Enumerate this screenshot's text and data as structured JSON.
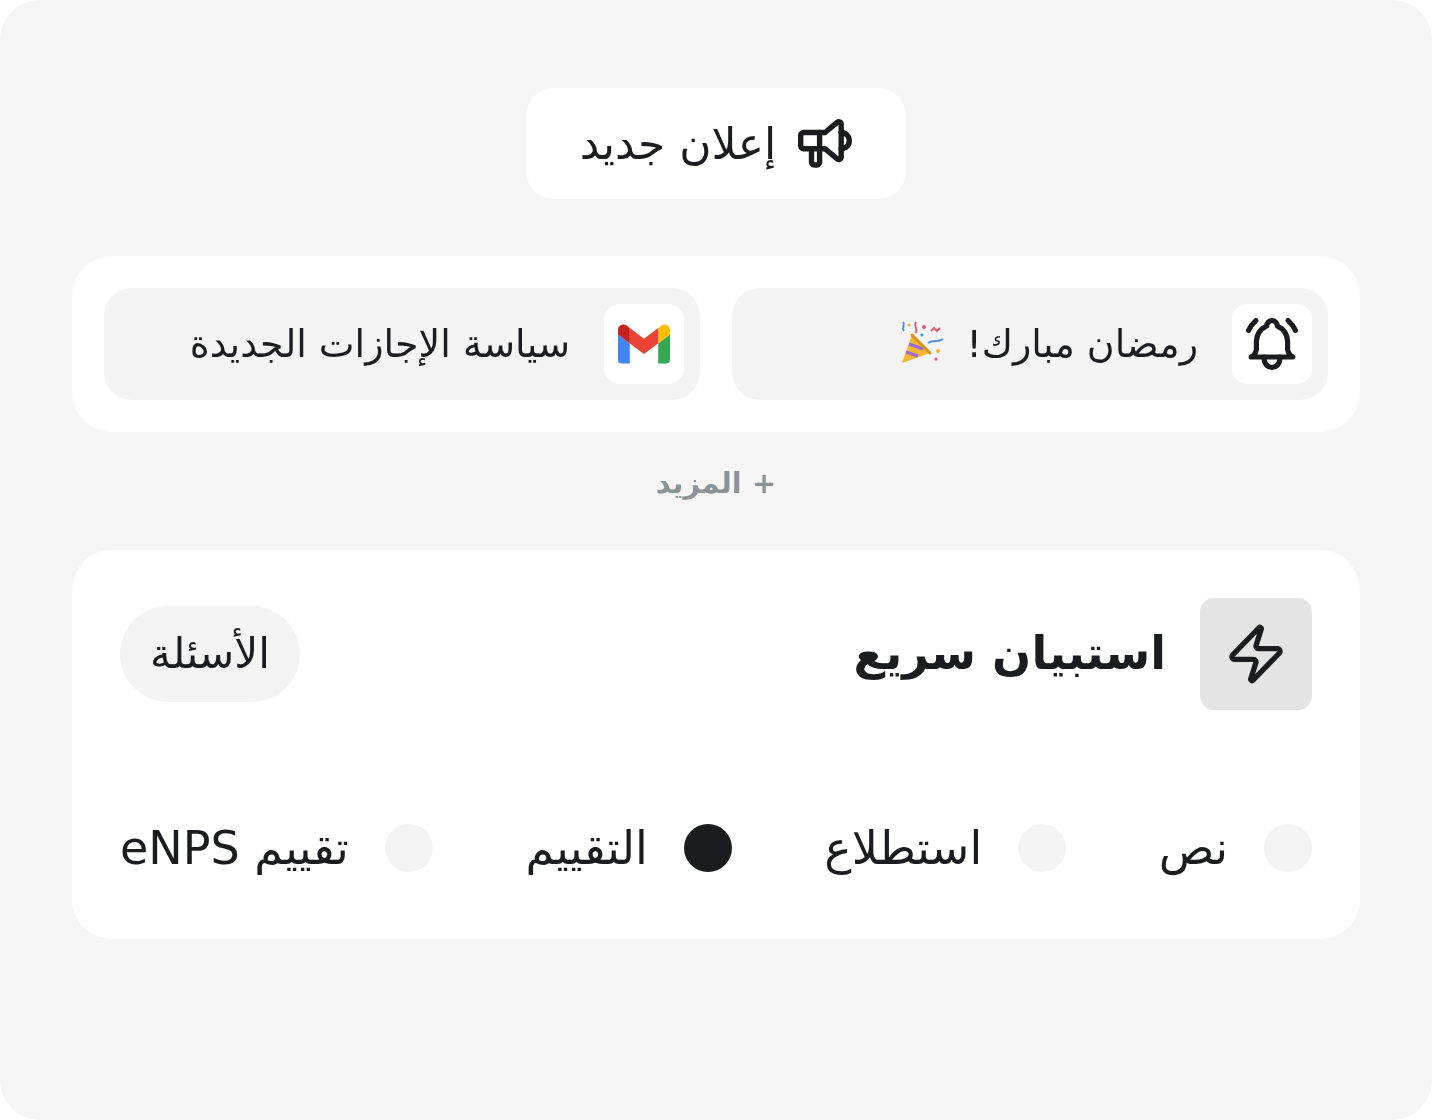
{
  "new_announcement_button": {
    "label": "إعلان جديد"
  },
  "announcements": [
    {
      "kind": "reminder",
      "title": "رمضان مبارك!",
      "celebration": true
    },
    {
      "kind": "email",
      "title": "سياسة الإجازات الجديدة",
      "celebration": false
    }
  ],
  "more_link": {
    "label": "+ المزيد"
  },
  "survey": {
    "title": "استبيان سريع",
    "questions_button": "الأسئلة",
    "options": [
      {
        "label": "نص",
        "selected": false
      },
      {
        "label": "استطلاع",
        "selected": false
      },
      {
        "label": "التقييم",
        "selected": true
      },
      {
        "label": "تقييم eNPS",
        "selected": false
      }
    ]
  }
}
